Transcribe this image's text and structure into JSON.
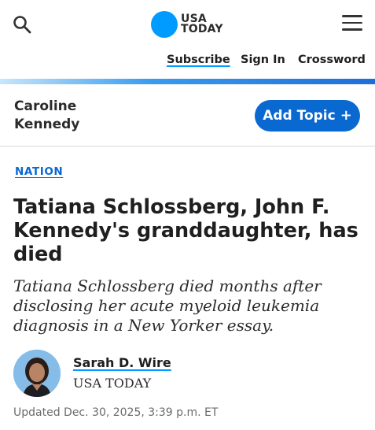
{
  "header": {
    "logo": {
      "line1": "USA",
      "line2": "TODAY",
      "dot_color": "#009bff"
    },
    "search_icon": "search-icon",
    "menu_icon": "hamburger-menu-icon"
  },
  "nav": {
    "subscribe": "Subscribe",
    "sign_in": "Sign In",
    "crossword": "Crossword"
  },
  "topic": {
    "name": "Caroline Kennedy",
    "add_button": "Add Topic",
    "add_icon": "+"
  },
  "article": {
    "section": "NATION",
    "headline": "Tatiana Schlossberg, John F. Kennedy's granddaughter, has died",
    "subhead": "Tatiana Schlossberg died months after disclosing her acute myeloid leukemia diagnosis in a New Yorker essay.",
    "author": {
      "name": "Sarah D. Wire",
      "org": "USA TODAY"
    },
    "updated": "Updated Dec. 30, 2025, 3:39 p.m. ET"
  },
  "colors": {
    "brand_blue": "#009bff",
    "button_blue": "#0a68d1"
  }
}
